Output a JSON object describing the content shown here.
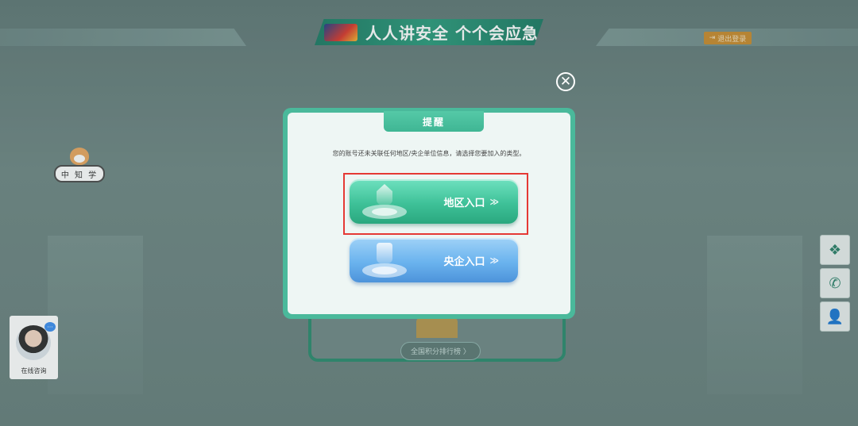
{
  "header": {
    "title": "人人讲安全 个个会应急",
    "logout_label": "退出登录"
  },
  "mascot": {
    "sign_text": "中 知 学"
  },
  "ranking": {
    "link_label": "全国积分排行榜 〉"
  },
  "consult": {
    "label": "在线咨询",
    "bubble": "···"
  },
  "sidebar": {
    "items": [
      {
        "icon": "wechat-icon",
        "glyph": "❖"
      },
      {
        "icon": "phone-icon",
        "glyph": "✆"
      },
      {
        "icon": "user-icon",
        "glyph": "👤"
      }
    ]
  },
  "modal": {
    "title": "提醒",
    "message": "您的账号还未关联任何地区/央企单位信息，请选择您要加入的类型。",
    "close_glyph": "✕",
    "region_entry": "地区入口",
    "central_entry": "央企入口",
    "chevron": "≫"
  },
  "colors": {
    "accent_green": "#3ec198",
    "accent_blue": "#6ab3ee",
    "highlight_red": "#e53935"
  }
}
